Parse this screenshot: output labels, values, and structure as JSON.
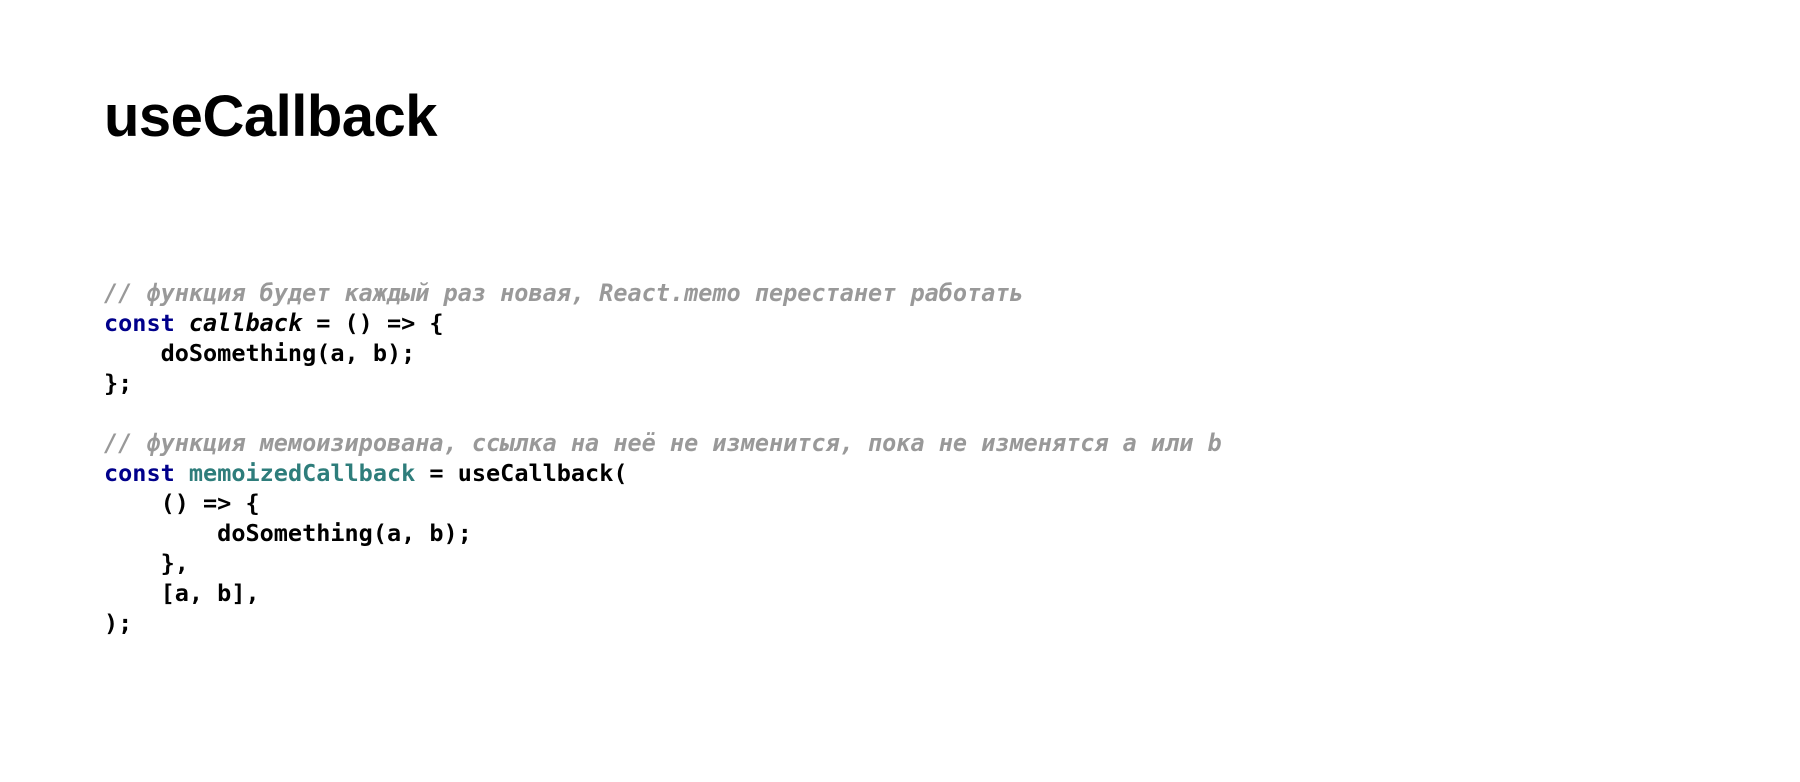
{
  "slide": {
    "title": "useCallback",
    "background_color": "#ffffff"
  },
  "palette": {
    "comment": "#999999",
    "keyword": "#00008B",
    "identifier_memo": "#2E7D7B",
    "plain": "#000000"
  },
  "code": {
    "language": "javascript",
    "lines": [
      {
        "id": "line-1",
        "type": "comment",
        "tokens": [
          {
            "style": "comment",
            "text": "// функция будет каждый раз новая, React.memo перестанет работать"
          }
        ]
      },
      {
        "id": "line-2",
        "type": "code",
        "tokens": [
          {
            "style": "keyword",
            "text": "const"
          },
          {
            "style": "plain",
            "text": " "
          },
          {
            "style": "fn-italic",
            "text": "callback"
          },
          {
            "style": "plain",
            "text": " = () => {"
          }
        ]
      },
      {
        "id": "line-3",
        "type": "code",
        "tokens": [
          {
            "style": "plain",
            "text": "    doSomething(a, b);"
          }
        ]
      },
      {
        "id": "line-4",
        "type": "code",
        "tokens": [
          {
            "style": "plain",
            "text": "};"
          }
        ]
      },
      {
        "id": "line-5",
        "type": "blank",
        "tokens": []
      },
      {
        "id": "line-6",
        "type": "comment",
        "tokens": [
          {
            "style": "comment",
            "text": "// функция мемоизирована, ссылка на неё не изменится, пока не изменятся a или b"
          }
        ]
      },
      {
        "id": "line-7",
        "type": "code",
        "tokens": [
          {
            "style": "keyword",
            "text": "const"
          },
          {
            "style": "plain",
            "text": " "
          },
          {
            "style": "memo",
            "text": "memoizedCallback"
          },
          {
            "style": "plain",
            "text": " = useCallback("
          }
        ]
      },
      {
        "id": "line-8",
        "type": "code",
        "tokens": [
          {
            "style": "plain",
            "text": "    () => {"
          }
        ]
      },
      {
        "id": "line-9",
        "type": "code",
        "tokens": [
          {
            "style": "plain",
            "text": "        doSomething(a, b);"
          }
        ]
      },
      {
        "id": "line-10",
        "type": "code",
        "tokens": [
          {
            "style": "plain",
            "text": "    },"
          }
        ]
      },
      {
        "id": "line-11",
        "type": "code",
        "tokens": [
          {
            "style": "plain",
            "text": "    [a, b],"
          }
        ]
      },
      {
        "id": "line-12",
        "type": "code",
        "tokens": [
          {
            "style": "plain",
            "text": ");"
          }
        ]
      }
    ]
  }
}
